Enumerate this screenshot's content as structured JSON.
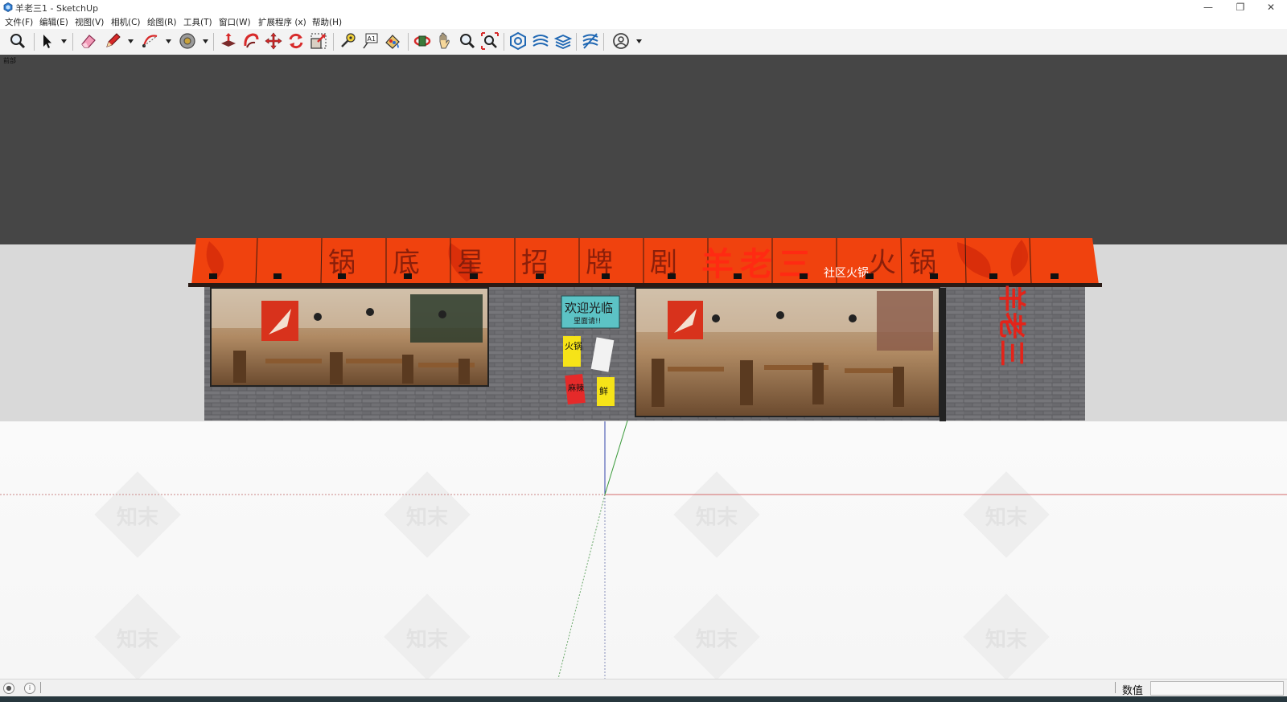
{
  "window": {
    "title": "羊老三1 - SketchUp",
    "minimize": "—",
    "restore": "❐",
    "close": "✕"
  },
  "menu": [
    "文件(F)",
    "编辑(E)",
    "视图(V)",
    "相机(C)",
    "绘图(R)",
    "工具(T)",
    "窗口(W)",
    "扩展程序 (x)",
    "帮助(H)"
  ],
  "toolbar": {
    "tools": [
      "zoom-icon",
      "select-icon",
      "eraser-icon",
      "pencil-icon",
      "arc-icon",
      "paint-bucket-icon",
      "push-pull-icon",
      "follow-me-icon",
      "move-icon",
      "rotate-icon",
      "scale-icon",
      "tape-measure-icon",
      "text-icon",
      "paint-icon",
      "orbit-icon",
      "pan-icon",
      "zoom-tool-icon",
      "zoom-extents-icon",
      "warehouse-icon",
      "extension-warehouse-icon",
      "layout-icon",
      "extension-manager-icon",
      "account-icon"
    ]
  },
  "viewport": {
    "scene_label": "前部",
    "watermark": "知末",
    "colors": {
      "sky": "#464646",
      "band": "#d9d9d9",
      "awning": "#f0420e"
    }
  },
  "storefront": {
    "awning_chars": [
      "锅",
      "底",
      "星",
      "招",
      "牌",
      "剧",
      "羊",
      "老",
      "三",
      "火",
      "锅"
    ],
    "sign_sub": "社区火锅",
    "poster_welcome": "欢迎光临",
    "poster_welcome_sub": "里面请!!",
    "poster_hotpot": "火锅",
    "poster_spicy": "麻辣",
    "poster_fresh": "鲜",
    "brand_vertical": "羊老三"
  },
  "statusbar": {
    "measurements_label": "数值",
    "measurements_value": ""
  }
}
